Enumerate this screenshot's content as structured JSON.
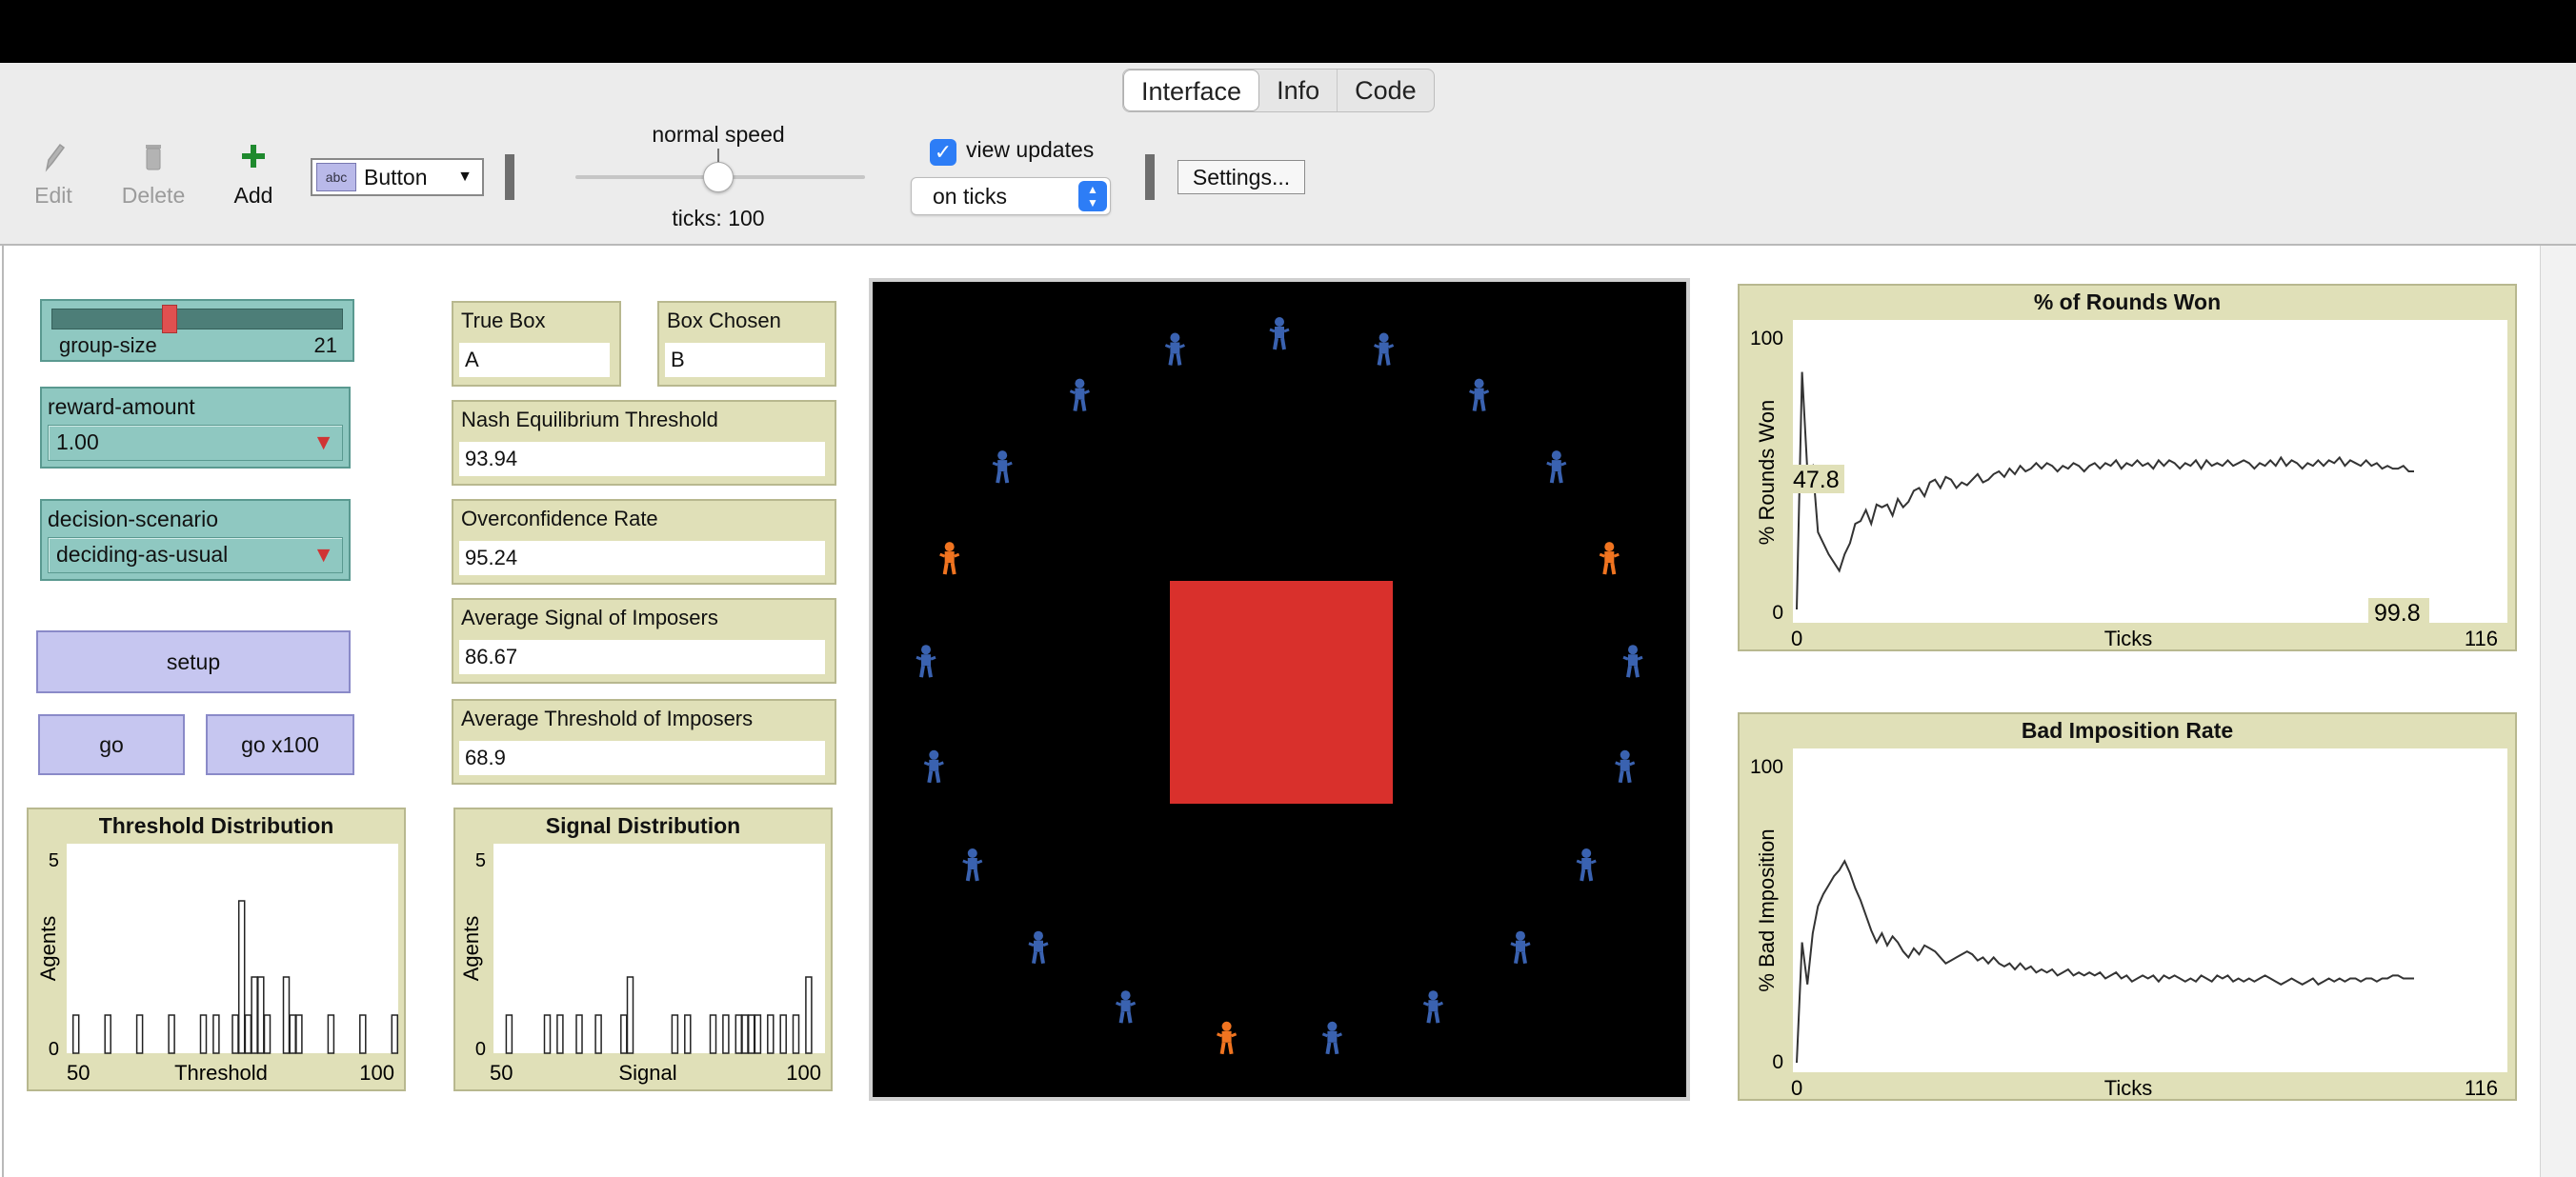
{
  "tabs": [
    "Interface",
    "Info",
    "Code"
  ],
  "toolbar": {
    "edit_label": "Edit",
    "delete_label": "Delete",
    "add_label": "Add",
    "widget_type": "Button",
    "speed_label": "normal speed",
    "ticks_label": "ticks: 100",
    "view_updates_label": "view updates",
    "view_updates_checked": true,
    "update_mode": "on ticks",
    "settings_label": "Settings..."
  },
  "controls": {
    "group_size": {
      "label": "group-size",
      "value": "21"
    },
    "reward_amount": {
      "label": "reward-amount",
      "value": "1.00"
    },
    "decision_scenario": {
      "label": "decision-scenario",
      "value": "deciding-as-usual"
    },
    "setup_label": "setup",
    "go_label": "go",
    "go100_label": "go x100"
  },
  "monitors": {
    "true_box": {
      "label": "True Box",
      "value": "A"
    },
    "box_chosen": {
      "label": "Box Chosen",
      "value": "B"
    },
    "nash": {
      "label": "Nash Equilibrium Threshold",
      "value": "93.94"
    },
    "overconfidence": {
      "label": "Overconfidence Rate",
      "value": "95.24"
    },
    "avg_signal": {
      "label": "Average Signal of Imposers",
      "value": "86.67"
    },
    "avg_threshold": {
      "label": "Average Threshold of Imposers",
      "value": "68.9"
    }
  },
  "colors": {
    "agent_blue": "#3a62b0",
    "agent_orange": "#f07420",
    "box_red": "#d9302c",
    "slider_teal": "#8fc8c1",
    "button_lilac": "#c6c6f0",
    "monitor_khaki": "#e0e0b8"
  },
  "world": {
    "agents": [
      "blue",
      "blue",
      "blue",
      "blue",
      "orange",
      "blue",
      "blue",
      "blue",
      "blue",
      "blue",
      "blue",
      "orange",
      "blue",
      "blue",
      "blue",
      "blue",
      "blue",
      "orange",
      "blue",
      "blue",
      "blue"
    ]
  },
  "chart_data": [
    {
      "id": "threshold_dist",
      "type": "bar",
      "title": "Threshold Distribution",
      "xlabel": "Threshold",
      "ylabel": "Agents",
      "xlim": [
        50,
        100
      ],
      "ylim": [
        0,
        5
      ],
      "x_ticks": [
        "50",
        "100"
      ],
      "y_ticks": [
        "0",
        "5"
      ],
      "bins": [
        [
          51,
          1
        ],
        [
          56,
          1
        ],
        [
          61,
          1
        ],
        [
          66,
          1
        ],
        [
          71,
          1
        ],
        [
          73,
          1
        ],
        [
          76,
          1
        ],
        [
          77,
          4
        ],
        [
          78,
          1
        ],
        [
          79,
          2
        ],
        [
          80,
          2
        ],
        [
          81,
          1
        ],
        [
          84,
          2
        ],
        [
          85,
          1
        ],
        [
          86,
          1
        ],
        [
          91,
          1
        ],
        [
          96,
          1
        ],
        [
          101,
          1
        ]
      ]
    },
    {
      "id": "signal_dist",
      "type": "bar",
      "title": "Signal Distribution",
      "xlabel": "Signal",
      "ylabel": "Agents",
      "xlim": [
        50,
        100
      ],
      "ylim": [
        0,
        5
      ],
      "x_ticks": [
        "50",
        "100"
      ],
      "y_ticks": [
        "0",
        "5"
      ],
      "bins": [
        [
          52,
          1
        ],
        [
          58,
          1
        ],
        [
          60,
          1
        ],
        [
          63,
          1
        ],
        [
          66,
          1
        ],
        [
          70,
          1
        ],
        [
          71,
          2
        ],
        [
          78,
          1
        ],
        [
          80,
          1
        ],
        [
          84,
          1
        ],
        [
          86,
          1
        ],
        [
          88,
          1
        ],
        [
          89,
          1
        ],
        [
          90,
          1
        ],
        [
          91,
          1
        ],
        [
          93,
          1
        ],
        [
          95,
          1
        ],
        [
          97,
          1
        ],
        [
          99,
          2
        ]
      ]
    },
    {
      "id": "rounds_won",
      "type": "line",
      "title": "% of Rounds Won",
      "xlabel": "Ticks",
      "ylabel": "% Rounds Won",
      "xlim": [
        0,
        116
      ],
      "ylim": [
        0,
        100
      ],
      "x_ticks": [
        "0",
        "116"
      ],
      "y_ticks": [
        "0",
        "100"
      ],
      "annotations": [
        "47.8",
        "99.8"
      ],
      "x": [
        0,
        1,
        2,
        3,
        4,
        5,
        6,
        7,
        8,
        9,
        10,
        11,
        12,
        13,
        14,
        15,
        16,
        17,
        18,
        19,
        20,
        21,
        22,
        23,
        24,
        25,
        26,
        27,
        28,
        29,
        30,
        31,
        32,
        33,
        34,
        35,
        36,
        37,
        38,
        39,
        40,
        41,
        42,
        43,
        44,
        45,
        46,
        47,
        48,
        49,
        50,
        51,
        52,
        53,
        54,
        55,
        56,
        57,
        58,
        59,
        60,
        61,
        62,
        63,
        64,
        65,
        66,
        67,
        68,
        69,
        70,
        71,
        72,
        73,
        74,
        75,
        76,
        77,
        78,
        79,
        80,
        81,
        82,
        83,
        84,
        85,
        86,
        87,
        88,
        89,
        90,
        91,
        92,
        93,
        94,
        95,
        96,
        97,
        98,
        99,
        100,
        101,
        102,
        103,
        104,
        105,
        106,
        107,
        108,
        109,
        110,
        111,
        112,
        113,
        114,
        115,
        116
      ],
      "values": [
        0,
        86,
        50,
        52,
        28,
        24,
        20,
        17,
        14,
        20,
        24,
        31,
        32,
        36,
        31,
        38,
        37,
        38,
        34,
        40,
        37,
        39,
        43,
        44,
        41,
        46,
        47,
        44,
        48,
        47,
        44,
        46,
        45,
        47,
        49,
        46,
        47,
        49,
        50,
        48,
        51,
        49,
        52,
        50,
        51,
        53,
        51,
        53,
        52,
        50,
        52,
        51,
        53,
        52,
        50,
        52,
        53,
        51,
        53,
        52,
        54,
        51,
        53,
        52,
        54,
        52,
        53,
        51,
        54,
        52,
        54,
        53,
        51,
        53,
        52,
        54,
        51,
        54,
        52,
        53,
        52,
        54,
        52,
        53,
        54,
        53,
        51,
        53,
        52,
        54,
        52,
        55,
        52,
        54,
        53,
        51,
        53,
        52,
        54,
        52,
        54,
        53,
        55,
        52,
        54,
        53,
        52,
        54,
        52,
        53,
        51,
        52,
        51,
        51,
        52,
        50,
        50
      ]
    },
    {
      "id": "bad_imposition",
      "type": "line",
      "title": "Bad Imposition Rate",
      "xlabel": "Ticks",
      "ylabel": "% Bad Imposition",
      "xlim": [
        0,
        116
      ],
      "ylim": [
        0,
        100
      ],
      "x_ticks": [
        "0",
        "116"
      ],
      "y_ticks": [
        "0",
        "100"
      ],
      "x": [
        0,
        1,
        2,
        3,
        4,
        5,
        6,
        7,
        8,
        9,
        10,
        11,
        12,
        13,
        14,
        15,
        16,
        17,
        18,
        19,
        20,
        21,
        22,
        23,
        24,
        25,
        26,
        27,
        28,
        29,
        30,
        31,
        32,
        33,
        34,
        35,
        36,
        37,
        38,
        39,
        40,
        41,
        42,
        43,
        44,
        45,
        46,
        47,
        48,
        49,
        50,
        51,
        52,
        53,
        54,
        55,
        56,
        57,
        58,
        59,
        60,
        61,
        62,
        63,
        64,
        65,
        66,
        67,
        68,
        69,
        70,
        71,
        72,
        73,
        74,
        75,
        76,
        77,
        78,
        79,
        80,
        81,
        82,
        83,
        84,
        85,
        86,
        87,
        88,
        89,
        90,
        91,
        92,
        93,
        94,
        95,
        96,
        97,
        98,
        99,
        100,
        101,
        102,
        103,
        104,
        105,
        106,
        107,
        108,
        109,
        110,
        111,
        112,
        113,
        114,
        115,
        116
      ],
      "values": [
        0,
        40,
        26,
        43,
        52,
        56,
        59,
        62,
        64,
        67,
        63,
        58,
        54,
        49,
        44,
        40,
        43,
        39,
        42,
        40,
        37,
        35,
        38,
        36,
        39,
        38,
        37,
        35,
        33,
        34,
        35,
        36,
        37,
        36,
        34,
        35,
        33,
        35,
        33,
        32,
        33,
        31,
        33,
        31,
        32,
        30,
        31,
        30,
        31,
        29,
        30,
        31,
        29,
        30,
        29,
        30,
        29,
        30,
        28,
        29,
        30,
        28,
        29,
        27,
        28,
        29,
        28,
        29,
        27,
        29,
        28,
        29,
        28,
        27,
        28,
        27,
        29,
        28,
        27,
        29,
        28,
        29,
        27,
        28,
        27,
        28,
        27,
        28,
        29,
        28,
        27,
        26,
        27,
        28,
        27,
        26,
        27,
        28,
        26,
        27,
        28,
        27,
        28,
        27,
        28,
        28,
        27,
        28,
        28,
        27,
        28,
        28,
        29,
        29,
        28,
        28,
        28
      ]
    }
  ]
}
